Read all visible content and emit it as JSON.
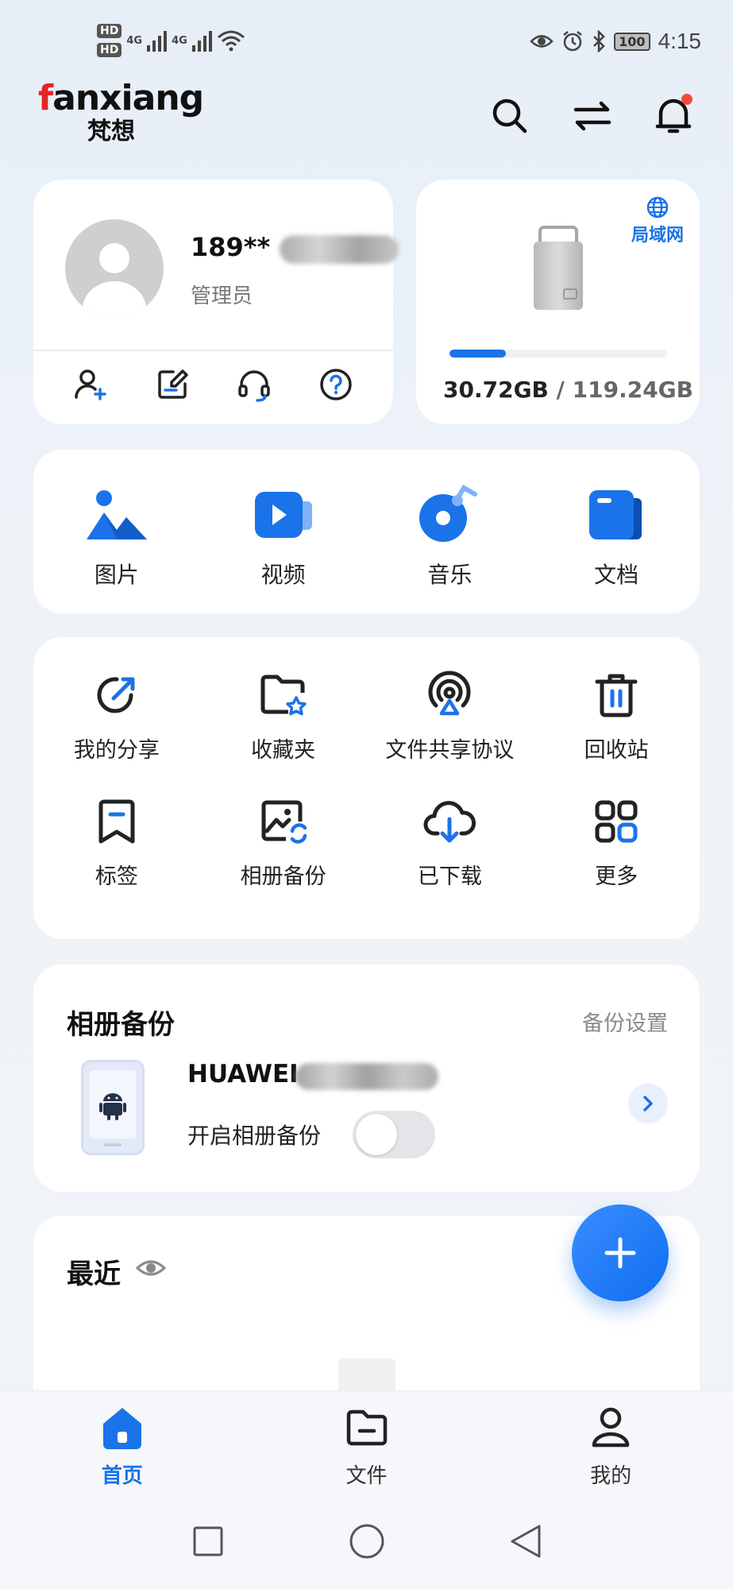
{
  "status_bar": {
    "hd1": "HD",
    "hd2": "HD",
    "net1": "4G",
    "net2": "4G",
    "battery": "100",
    "time": "4:15"
  },
  "header": {
    "logo_text_pre": "f",
    "logo_text_mid": "anxian",
    "logo_text_end": "g",
    "logo_sub": "梵想",
    "icons": [
      "search-icon",
      "transfer-icon",
      "bell-icon"
    ]
  },
  "profile": {
    "name": "189**",
    "role": "管理员",
    "actions": [
      "add-user-icon",
      "edit-icon",
      "headset-icon",
      "help-icon"
    ]
  },
  "device": {
    "network_label": "局域网",
    "used": "30.72GB",
    "separator": " / ",
    "total": "119.24GB",
    "used_fraction": 0.258
  },
  "media": [
    {
      "label": "图片",
      "icon": "image-icon"
    },
    {
      "label": "视频",
      "icon": "video-icon"
    },
    {
      "label": "音乐",
      "icon": "music-icon"
    },
    {
      "label": "文档",
      "icon": "document-icon"
    }
  ],
  "tools": [
    {
      "label": "我的分享",
      "icon": "share-icon"
    },
    {
      "label": "收藏夹",
      "icon": "favorites-folder-icon"
    },
    {
      "label": "文件共享协议",
      "icon": "protocol-icon"
    },
    {
      "label": "回收站",
      "icon": "trash-icon"
    },
    {
      "label": "标签",
      "icon": "tag-icon"
    },
    {
      "label": "相册备份",
      "icon": "album-backup-icon"
    },
    {
      "label": "已下载",
      "icon": "download-icon"
    },
    {
      "label": "更多",
      "icon": "more-grid-icon"
    }
  ],
  "backup": {
    "title": "相册备份",
    "settings": "备份设置",
    "device_name": "HUAWEI",
    "toggle_label": "开启相册备份",
    "toggle_on": false
  },
  "recent": {
    "title": "最近"
  },
  "bottom_nav": [
    {
      "label": "首页",
      "icon": "home-icon",
      "active": true
    },
    {
      "label": "文件",
      "icon": "folder-icon",
      "active": false
    },
    {
      "label": "我的",
      "icon": "profile-icon",
      "active": false
    }
  ],
  "colors": {
    "accent": "#1a73e8",
    "notification": "#f24a3d",
    "logo_red": "#e0262a"
  }
}
